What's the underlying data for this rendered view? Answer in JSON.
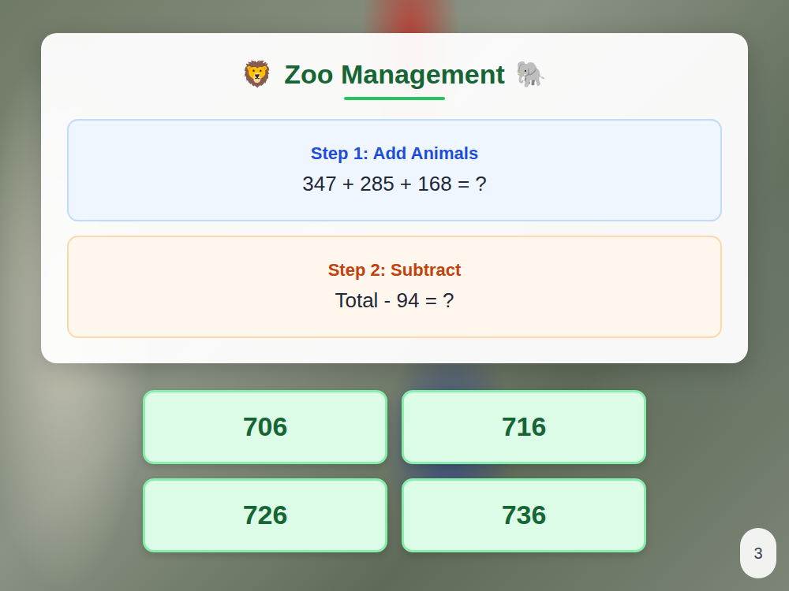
{
  "title": {
    "icon_left": "🦁",
    "text": "Zoo Management",
    "icon_right": "🐘"
  },
  "steps": [
    {
      "label": "Step 1: Add Animals",
      "equation": "347 + 285 + 168 = ?",
      "kind": "add"
    },
    {
      "label": "Step 2: Subtract",
      "equation": "Total - 94 = ?",
      "kind": "subtract"
    }
  ],
  "answers": [
    {
      "label": "706",
      "selected": false
    },
    {
      "label": "716",
      "selected": false
    },
    {
      "label": "726",
      "selected": false
    },
    {
      "label": "736",
      "selected": false
    }
  ],
  "page": "3"
}
